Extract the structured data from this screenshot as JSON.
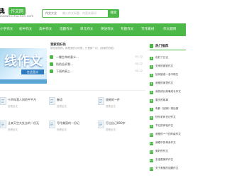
{
  "header": {
    "logo_text": "典",
    "logo_badge": "作文网",
    "logo_domain": "zuowenchuchen.com",
    "search_select": "作文大全",
    "search_placeholder": "输入作文标题、内容关键词",
    "search_button": "搜索"
  },
  "nav": {
    "items": [
      "小学作文",
      "初中作文",
      "高中作文",
      "话题作文",
      "单元作文",
      "英语作文",
      "专题作文",
      "写作素材",
      "作文题目"
    ]
  },
  "hero": {
    "big_text": "线作文",
    "bar_text": "在这里点",
    "colors": {
      "accent": "#4cb848"
    }
  },
  "hot": {
    "title": "我家的好处",
    "desc": "那些我觉得，那是我的小时候，只是那一切，(我家的好处)",
    "rows": [
      {
        "text": "一棵生命的意义…",
        "date": "03-12"
      },
      {
        "text": "奶奶告诉我…",
        "date": "03-12"
      },
      {
        "text": "下雨的高三…",
        "date": "03-12"
      }
    ]
  },
  "grid": [
    {
      "title": "十四年我人间的平平凡",
      "sub": "查看全文"
    },
    {
      "title": "春语",
      "sub": "查看全文"
    },
    {
      "title": "极致的一件",
      "sub": "查看全文"
    },
    {
      "title": "让来天空大处去的一份无",
      "sub": "查看全文"
    },
    {
      "title": "写作美丽的一份记",
      "sub": "查看全文"
    },
    {
      "title": "打出自己800字",
      "sub": "查看全文"
    }
  ],
  "sidebar": {
    "title": "热门推荐",
    "items": [
      "包好了日记",
      "关来的钢铁作文",
      "如何能成一名中职生",
      "我爱的家里作文",
      "我的成长故事成长作文",
      "春天的故事",
      "电影《战狼》观后感",
      "快乐老师日记作文",
      "节日的体验作文",
      "我爱的一个四年级作文",
      "我眼中的母亲作文",
      "美好的作文",
      "友谊是美好作文",
      "关于美丽的话题作文"
    ]
  }
}
